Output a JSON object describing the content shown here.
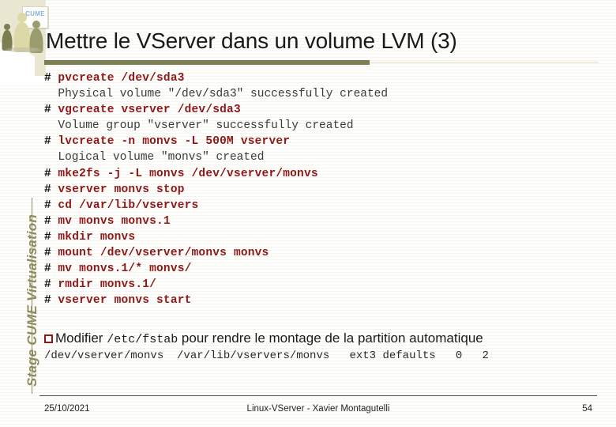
{
  "slide": {
    "title": "Mettre le VServer dans un volume LVM (3)",
    "sidebar_label": "Stage CUME Virtualisation",
    "logo_board_text": "CUME"
  },
  "colors": {
    "title_rule": "#7e7f52",
    "command_text": "#8f1717",
    "sidebar_text": "#8d8c5c",
    "cream_block": "#e9e7d2",
    "board_text": "#86b4d8"
  },
  "code": {
    "prompt": "# ",
    "lines": [
      {
        "type": "command",
        "text": "pvcreate /dev/sda3"
      },
      {
        "type": "output",
        "text": "  Physical volume \"/dev/sda3\" successfully created"
      },
      {
        "type": "command",
        "text": "vgcreate vserver /dev/sda3"
      },
      {
        "type": "output",
        "text": "  Volume group \"vserver\" successfully created"
      },
      {
        "type": "command",
        "text": "lvcreate -n monvs -L 500M vserver"
      },
      {
        "type": "output",
        "text": "  Logical volume \"monvs\" created"
      },
      {
        "type": "command",
        "text": "mke2fs -j -L monvs /dev/vserver/monvs"
      },
      {
        "type": "command",
        "text": "vserver monvs stop"
      },
      {
        "type": "command",
        "text": "cd /var/lib/vservers"
      },
      {
        "type": "command",
        "text": "mv monvs monvs.1"
      },
      {
        "type": "command",
        "text": "mkdir monvs"
      },
      {
        "type": "command",
        "text": "mount /dev/vserver/monvs monvs"
      },
      {
        "type": "command",
        "text": "mv monvs.1/* monvs/"
      },
      {
        "type": "command",
        "text": "rmdir monvs.1/"
      },
      {
        "type": "command",
        "text": "vserver monvs start"
      }
    ]
  },
  "bullet": {
    "marker": "open-square",
    "part1": "Modifier ",
    "mono": "/etc/fstab",
    "part2": " pour rendre le montage de la partition automatique"
  },
  "fstab_line": "/dev/vserver/monvs  /var/lib/vservers/monvs   ext3 defaults   0   2",
  "footer": {
    "date": "25/10/2021",
    "center": "Linux-VServer - Xavier Montagutelli",
    "page": "54"
  }
}
